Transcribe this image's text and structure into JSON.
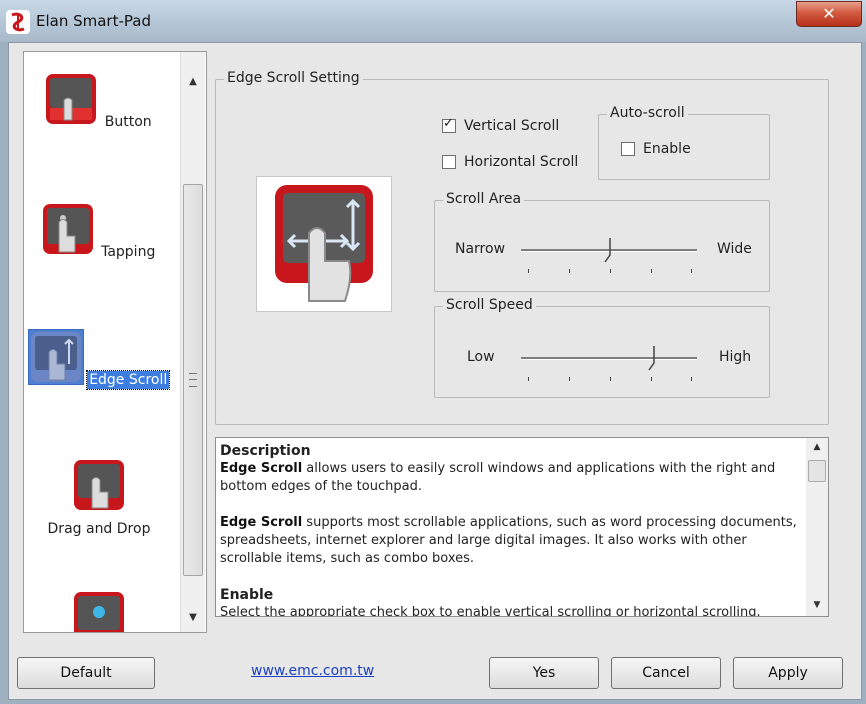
{
  "window": {
    "title": "Elan Smart-Pad",
    "close_label": "✕"
  },
  "sidebar": {
    "items": [
      {
        "label": "Button"
      },
      {
        "label": "Tapping"
      },
      {
        "label": "Edge Scroll",
        "selected": true
      },
      {
        "label": "Drag and Drop"
      },
      {
        "label": ""
      }
    ],
    "scroll_up": "▲",
    "scroll_down": "▼"
  },
  "edge_scroll": {
    "group_title": "Edge Scroll Setting",
    "vertical_scroll": {
      "label": "Vertical Scroll",
      "checked": true
    },
    "horizontal_scroll": {
      "label": "Horizontal Scroll",
      "checked": false
    },
    "auto_scroll": {
      "title": "Auto-scroll",
      "enable_label": "Enable",
      "checked": false
    },
    "scroll_area": {
      "title": "Scroll Area",
      "min_label": "Narrow",
      "max_label": "Wide",
      "value_fraction": 0.5
    },
    "scroll_speed": {
      "title": "Scroll Speed",
      "min_label": "Low",
      "max_label": "High",
      "value_fraction": 0.75
    }
  },
  "description": {
    "heading": "Description",
    "p1_bold": "Edge Scroll",
    "p1_text": " allows users to easily scroll windows and applications with the right and bottom edges of the touchpad.",
    "p2_bold": "Edge Scroll",
    "p2_text": " supports most scrollable applications, such as word processing documents, spreadsheets, internet explorer and large digital images. It also works with other scrollable items, such as combo boxes.",
    "h2": "Enable",
    "p3_text": "Select the appropriate check box to enable vertical scrolling or horizontal scrolling.",
    "scroll_up": "▲",
    "scroll_down": "▼"
  },
  "footer": {
    "default_label": "Default",
    "link_text": "www.emc.com.tw",
    "yes_label": "Yes",
    "cancel_label": "Cancel",
    "apply_label": "Apply"
  },
  "colors": {
    "accent_red": "#c8161d",
    "selection_blue": "#3e7de0",
    "link": "#1a3fc0"
  }
}
